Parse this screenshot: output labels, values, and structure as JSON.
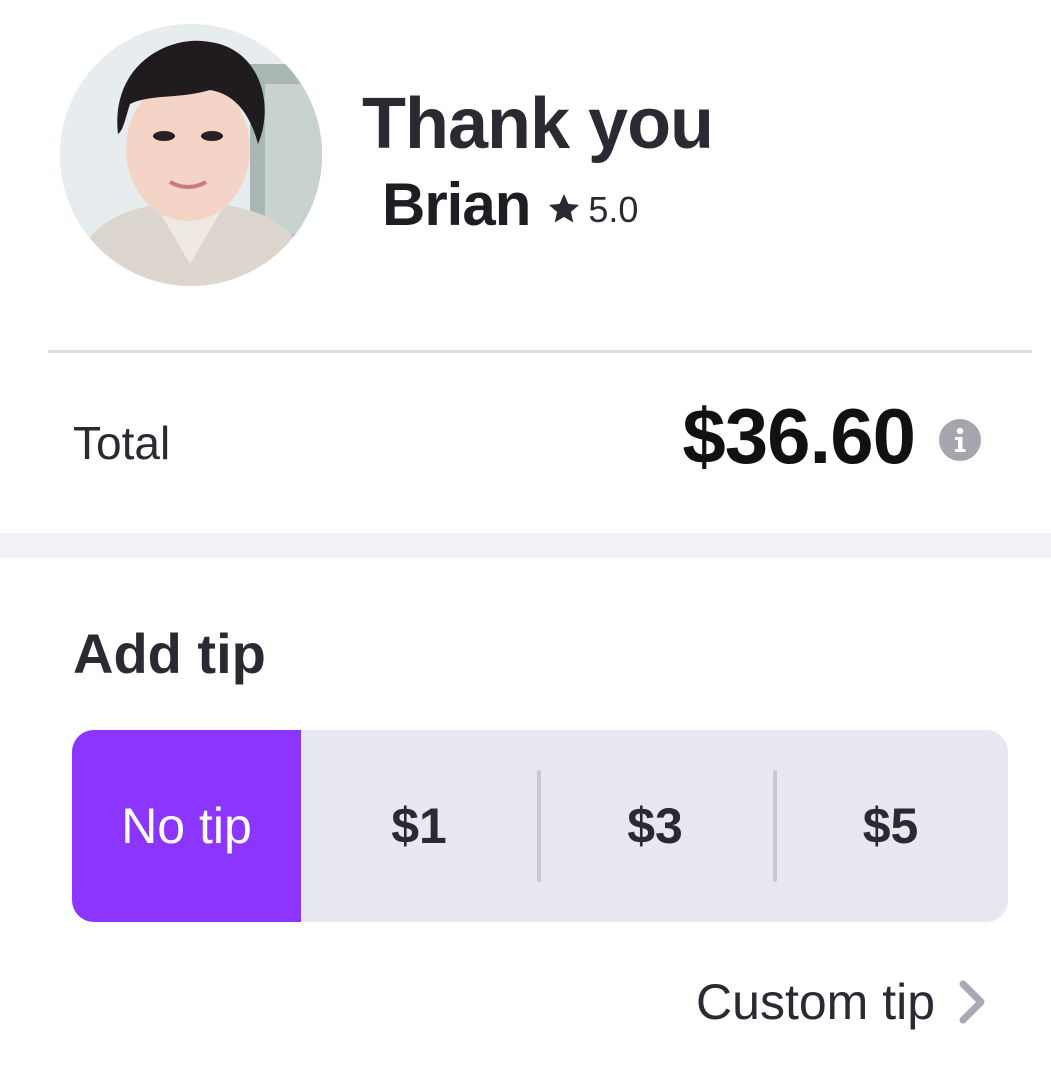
{
  "header": {
    "title": "Thank you",
    "driver_name": "Brian",
    "rating": "5.0",
    "icons": {
      "avatar": "driver-avatar",
      "rating": "star-icon"
    }
  },
  "summary": {
    "total_label": "Total",
    "total_amount": "$36.60",
    "info_icon": "info-icon"
  },
  "tip": {
    "heading": "Add tip",
    "options": [
      "No tip",
      "$1",
      "$3",
      "$5"
    ],
    "selected": "No tip",
    "custom_label": "Custom tip",
    "custom_icon": "chevron-right-icon"
  },
  "colors": {
    "accent": "#8c35ff",
    "text": "#2a2a33",
    "segment_bg": "#e8e8f0"
  }
}
